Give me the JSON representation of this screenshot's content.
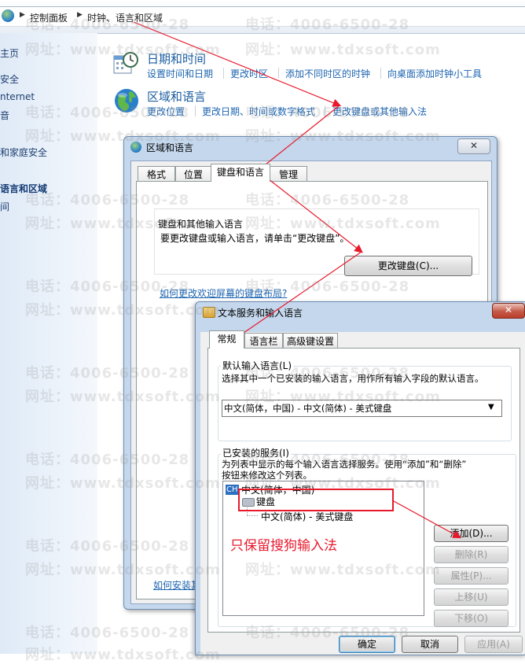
{
  "address_bar": {
    "crumbs": [
      "控制面板",
      "时钟、语言和区域"
    ]
  },
  "left_pane": {
    "items": [
      "主页",
      "安全",
      "nternet",
      "音",
      "和家庭安全",
      "语言和区域",
      "间"
    ]
  },
  "main": {
    "datetime": {
      "title": "日期和时间",
      "links": [
        "设置时间和日期",
        "更改时区",
        "添加不同时区的时钟",
        "向桌面添加时钟小工具"
      ]
    },
    "region": {
      "title": "区域和语言",
      "links": [
        "更改位置",
        "更改日期、时间或数字格式",
        "更改键盘或其他输入法"
      ]
    }
  },
  "region_dialog": {
    "title": "区域和语言",
    "close_label": "✕",
    "tabs": [
      "格式",
      "位置",
      "键盘和语言",
      "管理"
    ],
    "section_title": "键盘和其他输入语言",
    "section_desc": "要更改键盘或输入语言，请单击“更改键盘”。",
    "change_keyboard_button": "更改键盘(C)...",
    "welcome_link": "如何更改欢迎屏幕的键盘布局?",
    "install_link": "如何安装其"
  },
  "text_services_dialog": {
    "title": "文本服务和输入语言",
    "close_label": "✕",
    "tabs": [
      "常规",
      "语言栏",
      "高级键设置"
    ],
    "default_group": {
      "legend": "默认输入语言(L)",
      "desc": "选择其中一个已安装的输入语言，用作所有输入字段的默认语言。",
      "selected": "中文(简体，中国) - 中文(简体) - 美式键盘"
    },
    "installed_group": {
      "legend": "已安装的服务(I)",
      "desc_line1": "为列表中显示的每个输入语言选择服务。使用“添加”和“删除”",
      "desc_line2": "按钮来修改这个列表。",
      "tree": {
        "lang_badge": "CH",
        "language": "中文(简体，中国)",
        "category": "键盘",
        "service": "中文(简体) - 美式键盘"
      }
    },
    "side_buttons": [
      "添加(D)...",
      "删除(R)",
      "属性(P)...",
      "上移(U)",
      "下移(O)"
    ],
    "bottom_buttons": [
      "确定",
      "取消",
      "应用(A)"
    ]
  },
  "annotation": {
    "text": "只保留搜狗输入法",
    "color": "#e8192c"
  },
  "watermark": {
    "phone": "电话：4006-6500-28",
    "site": "网址：www.tdxsoft.com"
  },
  "colors": {
    "link": "#1c64b0",
    "title": "#1a5c9f",
    "arrow": "#e8192c"
  }
}
